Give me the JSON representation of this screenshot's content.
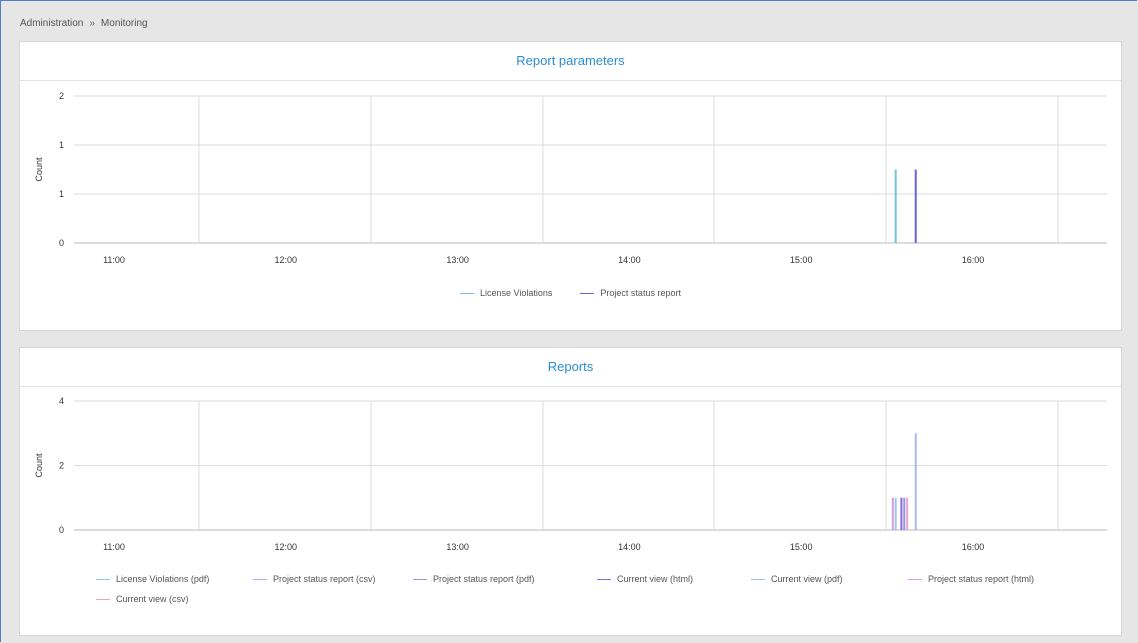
{
  "breadcrumb": {
    "items": [
      "Administration",
      "Monitoring"
    ],
    "separator": "»"
  },
  "panels": [
    {
      "title": "Report parameters"
    },
    {
      "title": "Reports"
    }
  ],
  "colors": {
    "accent": "#2b8dd0",
    "frame": "#4d7cc7"
  },
  "chart_data": [
    {
      "type": "bar",
      "title": "Report parameters",
      "ylabel": "Count",
      "xlabel": "",
      "x_ticks": [
        "11:00",
        "12:00",
        "13:00",
        "14:00",
        "15:00",
        "16:00"
      ],
      "y_ticks": [
        "0",
        "1",
        "1",
        "2"
      ],
      "ylim": [
        0,
        2
      ],
      "grid": true,
      "legend_position": "bottom",
      "series": [
        {
          "name": "License Violations",
          "color": "#72c3dd",
          "points": [
            {
              "x": "15:33",
              "y": 1
            }
          ]
        },
        {
          "name": "Project status report",
          "color": "#6b62e0",
          "points": [
            {
              "x": "15:40",
              "y": 1
            }
          ]
        }
      ]
    },
    {
      "type": "bar",
      "title": "Reports",
      "ylabel": "Count",
      "xlabel": "",
      "x_ticks": [
        "11:00",
        "12:00",
        "13:00",
        "14:00",
        "15:00",
        "16:00"
      ],
      "y_ticks": [
        "0",
        "2",
        "4"
      ],
      "ylim": [
        0,
        4
      ],
      "grid": true,
      "legend_position": "bottom",
      "series": [
        {
          "name": "License Violations (pdf)",
          "color": "#9ac7e8",
          "points": [
            {
              "x": "15:33",
              "y": 1
            }
          ]
        },
        {
          "name": "Project status report (csv)",
          "color": "#b2a7ef",
          "points": [
            {
              "x": "15:35",
              "y": 1
            }
          ]
        },
        {
          "name": "Project status report (pdf)",
          "color": "#9c92ec",
          "points": [
            {
              "x": "15:36",
              "y": 1
            }
          ]
        },
        {
          "name": "Current view (html)",
          "color": "#8a6ed6",
          "points": [
            {
              "x": "15:35",
              "y": 1
            }
          ]
        },
        {
          "name": "Current view (pdf)",
          "color": "#a9b9e6",
          "points": [
            {
              "x": "15:40",
              "y": 3
            }
          ]
        },
        {
          "name": "Project status report (html)",
          "color": "#d89ae0",
          "points": [
            {
              "x": "15:32",
              "y": 1
            }
          ]
        },
        {
          "name": "Current view (csv)",
          "color": "#e8a7c9",
          "points": [
            {
              "x": "15:37",
              "y": 1
            }
          ]
        }
      ]
    }
  ]
}
